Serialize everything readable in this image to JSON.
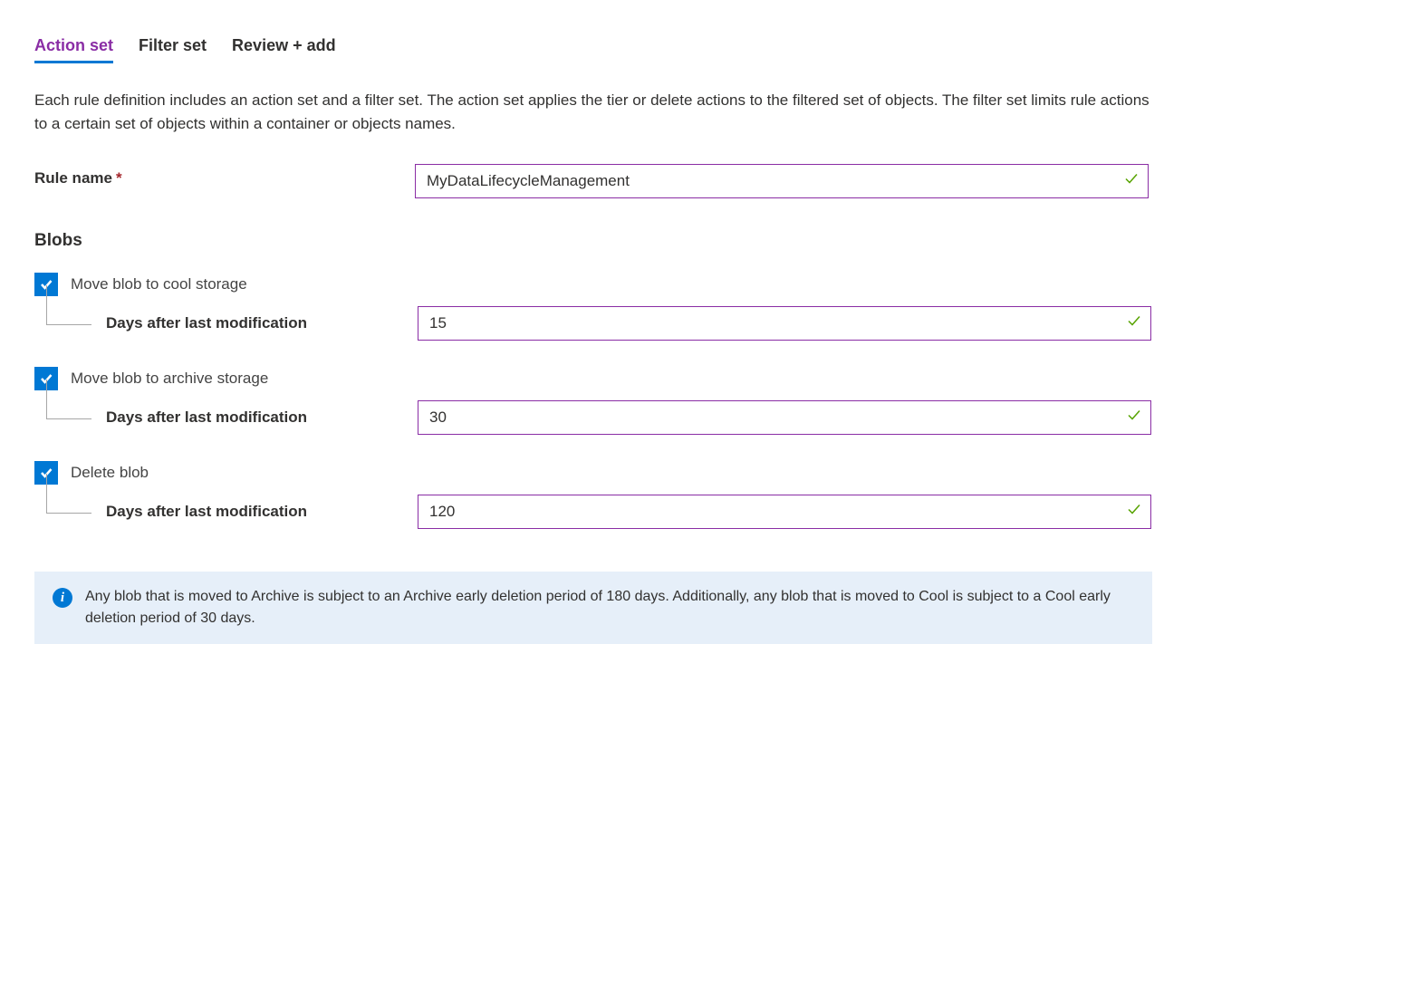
{
  "tabs": {
    "action_set": "Action set",
    "filter_set": "Filter set",
    "review_add": "Review + add"
  },
  "description": "Each rule definition includes an action set and a filter set. The action set applies the tier or delete actions to the filtered set of objects. The filter set limits rule actions to a certain set of objects within a container or objects names.",
  "rule_name": {
    "label": "Rule name",
    "value": "MyDataLifecycleManagement"
  },
  "blobs": {
    "heading": "Blobs",
    "days_label": "Days after last modification",
    "cool": {
      "label": "Move blob to cool storage",
      "checked": true,
      "days": "15"
    },
    "archive": {
      "label": "Move blob to archive storage",
      "checked": true,
      "days": "30"
    },
    "delete": {
      "label": "Delete blob",
      "checked": true,
      "days": "120"
    }
  },
  "info_message": "Any blob that is moved to Archive is subject to an Archive early deletion period of 180 days. Additionally, any blob that is moved to Cool is subject to a Cool early deletion period of 30 days."
}
